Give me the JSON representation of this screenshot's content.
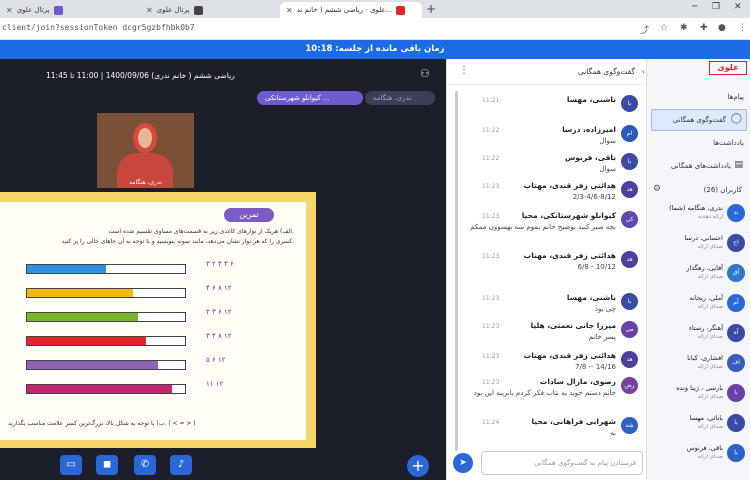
{
  "browser": {
    "tabs": [
      {
        "label": "پرتال علوی",
        "active": false
      },
      {
        "label": "پرتال علوی",
        "active": false
      },
      {
        "label": "علوی - ریاضی ششم ( خانم ند...",
        "active": true
      }
    ],
    "url": "client/join?sessionToken   dcgr5gzbfhbk0b7"
  },
  "session": {
    "timer_label": "زمان باقی مانده از جلسه: 10:18",
    "title": "ریاضی ششم ( خانم ندری) 1400/09/06 | 11:00 تا 11:45",
    "presenter_chip": "کیوانلو شهرستانکی ...",
    "recording_chip": "ندری، هنگامه",
    "camera_name": "ندری، هنگامه"
  },
  "slide": {
    "label": "تمرین",
    "line1": "الف) هریک از نوارهای کاغذی زیر به قسمت‌های مساوی تقسیم شده است.",
    "line2": "کسری را که هر نوار نشان می‌دهد، مانند نمونه بنویسید و با توجه به آن جاهای خالی را پر کنید.",
    "rows": [
      {
        "color": "#2f8fe0",
        "fill": 0.5,
        "frac": "۳  ۲  ۳  ۳  ۶"
      },
      {
        "color": "#f2b711",
        "fill": 0.67,
        "frac": "۴  ۶  ۸  ۱۲"
      },
      {
        "color": "#76b82a",
        "fill": 0.7,
        "frac": "۲  ۳  ۶  ۱۲"
      },
      {
        "color": "#e2242a",
        "fill": 0.75,
        "frac": "۳  ۴  ۸  ۱۲"
      },
      {
        "color": "#8e63b5",
        "fill": 0.83,
        "frac": "۵  ۶  ۱۲"
      },
      {
        "color": "#c2266e",
        "fill": 0.92,
        "frac": "۱۱  ۱۲"
      }
    ],
    "foot": "ب) با توجه به شکل بالا، بزرگ‌ترین کسر علامت مناسب بگذارید. ( < = > )"
  },
  "chat": {
    "header": "گفت‌وگوی همگانی",
    "input_placeholder": "فرستادن پیام به گفت‌وگوی همگانی",
    "messages": [
      {
        "name": "باشنی، مهسا",
        "time": "11:21",
        "text": "",
        "avatar": "با",
        "color": "#3b4aa5"
      },
      {
        "name": "امیرزاده، درسا",
        "time": "11:22",
        "text": "سوال",
        "avatar": "ام",
        "color": "#2a5bb8"
      },
      {
        "name": "باقی، فرنوس",
        "time": "11:22",
        "text": "سوال",
        "avatar": "با",
        "color": "#3b4aa5"
      },
      {
        "name": "هدائتی زفر قندی، مهتاب",
        "time": "11:23",
        "text": "2/3-4/6-8/12",
        "avatar": "هد",
        "color": "#4b3fa0"
      },
      {
        "name": "کیوانلو شهرستانکی، محیا",
        "time": "11:23",
        "text": "بچه صبر کنید بوضیح خانم بموم سه بهسوون ممکم",
        "avatar": "کی",
        "color": "#5e48b0"
      },
      {
        "name": "هدائتی زفر قندی، مهتاب",
        "time": "11:23",
        "text": "6/8 - 10/12",
        "avatar": "هد",
        "color": "#4b3fa0"
      },
      {
        "name": "باشنی، مهسا",
        "time": "11:23",
        "text": "چی بود",
        "avatar": "با",
        "color": "#3b4aa5"
      },
      {
        "name": "میرزا جانی نعمتی، هلیا",
        "time": "11:23",
        "text": "پسر خانم",
        "avatar": "می",
        "color": "#6b3fa8"
      },
      {
        "name": "هدائتی زفر قندی، مهتاب",
        "time": "11:23",
        "text": "7/8 -- 14/16",
        "avatar": "هد",
        "color": "#4b3fa0"
      },
      {
        "name": "رضوی، مارال سادات",
        "time": "11:23",
        "text": "خانم دستم جوید به نتاب فکر کردم بانرینه این بود",
        "avatar": "رض",
        "color": "#7a3fa0"
      },
      {
        "name": "شهرابی فراهانی، محیا",
        "time": "11:24",
        "text": "نه",
        "avatar": "شه",
        "color": "#2c62c8"
      }
    ]
  },
  "sidebar": {
    "logo": "علوی",
    "messages_label": "پیام‌ها",
    "public_chat": "گفت‌وگوی همگانی",
    "notes_label": "یادداشت‌ها",
    "shared_notes": "یادداشت‌های همگانی",
    "users_label": "کاربران (26)",
    "users": [
      {
        "name": "ندری، هنگامه (شما)",
        "sub": "ارائه دهنده",
        "avatar": "ند",
        "color": "#2a67d9"
      },
      {
        "name": "احسانی، درسا",
        "sub": "صدای ارائه",
        "avatar": "اح",
        "color": "#3b4aa5"
      },
      {
        "name": "آقایی، رهگذار",
        "sub": "صدای ارائه",
        "avatar": "آق",
        "color": "#2d78c8"
      },
      {
        "name": "آملی، ریحانه",
        "sub": "صدای ارائه",
        "avatar": "آم",
        "color": "#2a67d9"
      },
      {
        "name": "آهنگر، رستاء",
        "sub": "صدای ارائه",
        "avatar": "آه",
        "color": "#3b4aa5"
      },
      {
        "name": "افشاری، کیانا",
        "sub": "صدای ارائه",
        "avatar": "اف",
        "color": "#3a5bbf"
      },
      {
        "name": "بارسی ، ژینا ونده",
        "sub": "صدای ارائه",
        "avatar": "با",
        "color": "#6b3fa8"
      },
      {
        "name": "بابائی، مهسا",
        "sub": "صدای ارائه",
        "avatar": "با",
        "color": "#3b4aa5"
      },
      {
        "name": "باقی، فرنوس",
        "sub": "صدای ارائه",
        "avatar": "با",
        "color": "#2c62c8"
      }
    ]
  }
}
